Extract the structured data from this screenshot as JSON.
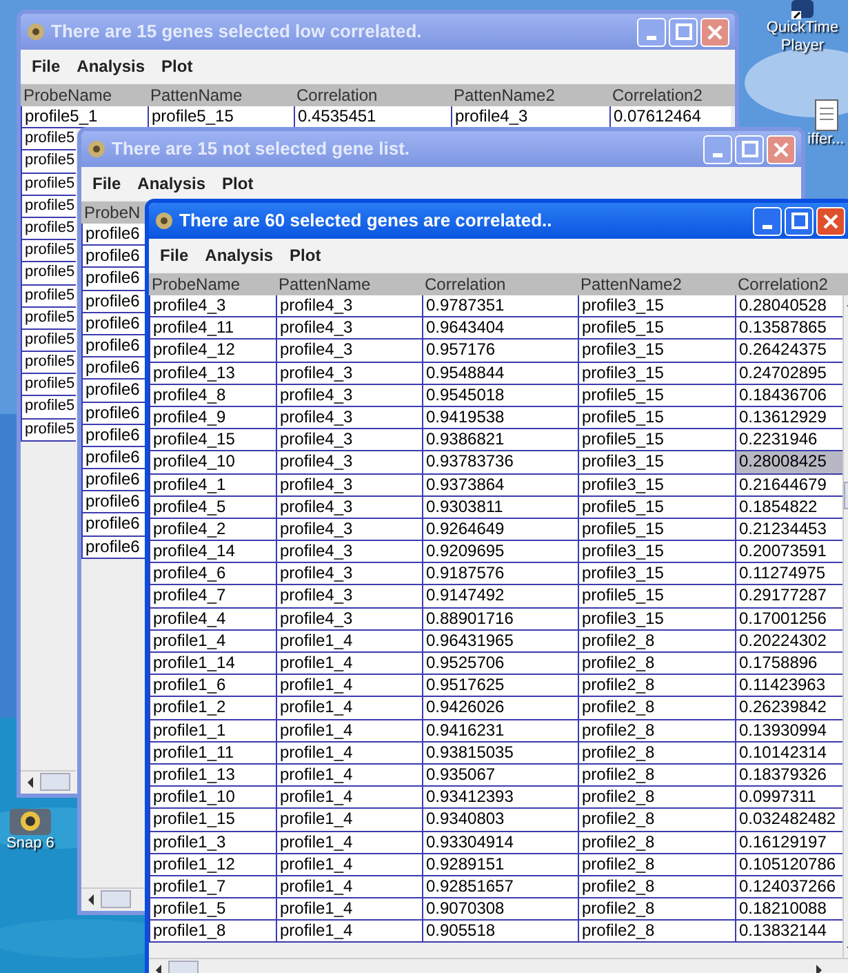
{
  "desktop_icons": [
    {
      "label": "QuickTime Player",
      "kind": "app"
    },
    {
      "label": "iffer...",
      "kind": "document"
    },
    {
      "label": "Snap 6",
      "kind": "camera"
    }
  ],
  "windows": [
    {
      "title": "There are 15 genes selected low correlated.",
      "active": false,
      "menu": [
        "File",
        "Analysis",
        "Plot"
      ],
      "columns": [
        "ProbeName",
        "PattenName",
        "Correlation",
        "PattenName2",
        "Correlation2"
      ],
      "rows": [
        [
          "profile5_1",
          "profile5_15",
          "0.4535451",
          "profile4_3",
          "0.07612464"
        ],
        [
          "profile5"
        ],
        [
          "profile5"
        ],
        [
          "profile5"
        ],
        [
          "profile5"
        ],
        [
          "profile5"
        ],
        [
          "profile5"
        ],
        [
          "profile5"
        ],
        [
          "profile5"
        ],
        [
          "profile5"
        ],
        [
          "profile5"
        ],
        [
          "profile5"
        ],
        [
          "profile5"
        ],
        [
          "profile5"
        ],
        [
          "profile5"
        ]
      ]
    },
    {
      "title": "There are 15 not selected gene list.",
      "active": false,
      "menu": [
        "File",
        "Analysis",
        "Plot"
      ],
      "columns": [
        "ProbeN"
      ],
      "rows": [
        [
          "profile6"
        ],
        [
          "profile6"
        ],
        [
          "profile6"
        ],
        [
          "profile6"
        ],
        [
          "profile6"
        ],
        [
          "profile6"
        ],
        [
          "profile6"
        ],
        [
          "profile6"
        ],
        [
          "profile6"
        ],
        [
          "profile6"
        ],
        [
          "profile6"
        ],
        [
          "profile6"
        ],
        [
          "profile6"
        ],
        [
          "profile6"
        ],
        [
          "profile6"
        ]
      ]
    },
    {
      "title": "There are 60 selected genes are correlated..",
      "active": true,
      "menu": [
        "File",
        "Analysis",
        "Plot"
      ],
      "columns": [
        "ProbeName",
        "PattenName",
        "Correlation",
        "PattenName2",
        "Correlation2"
      ],
      "rows": [
        {
          "cells": [
            "profile4_3",
            "profile4_3",
            "0.9787351",
            "profile3_15",
            "0.28040528"
          ],
          "selected": false
        },
        {
          "cells": [
            "profile4_11",
            "profile4_3",
            "0.9643404",
            "profile5_15",
            "0.13587865"
          ],
          "selected": false
        },
        {
          "cells": [
            "profile4_12",
            "profile4_3",
            "0.957176",
            "profile3_15",
            "0.26424375"
          ],
          "selected": false
        },
        {
          "cells": [
            "profile4_13",
            "profile4_3",
            "0.9548844",
            "profile3_15",
            "0.24702895"
          ],
          "selected": false
        },
        {
          "cells": [
            "profile4_8",
            "profile4_3",
            "0.9545018",
            "profile5_15",
            "0.18436706"
          ],
          "selected": false
        },
        {
          "cells": [
            "profile4_9",
            "profile4_3",
            "0.9419538",
            "profile5_15",
            "0.13612929"
          ],
          "selected": false
        },
        {
          "cells": [
            "profile4_15",
            "profile4_3",
            "0.9386821",
            "profile5_15",
            "0.2231946"
          ],
          "selected": false
        },
        {
          "cells": [
            "profile4_10",
            "profile4_3",
            "0.93783736",
            "profile3_15",
            "0.28008425"
          ],
          "selected": true
        },
        {
          "cells": [
            "profile4_1",
            "profile4_3",
            "0.9373864",
            "profile3_15",
            "0.21644679"
          ],
          "selected": false
        },
        {
          "cells": [
            "profile4_5",
            "profile4_3",
            "0.9303811",
            "profile5_15",
            "0.1854822"
          ],
          "selected": false
        },
        {
          "cells": [
            "profile4_2",
            "profile4_3",
            "0.9264649",
            "profile5_15",
            "0.21234453"
          ],
          "selected": false
        },
        {
          "cells": [
            "profile4_14",
            "profile4_3",
            "0.9209695",
            "profile3_15",
            "0.20073591"
          ],
          "selected": false
        },
        {
          "cells": [
            "profile4_6",
            "profile4_3",
            "0.9187576",
            "profile3_15",
            "0.11274975"
          ],
          "selected": false
        },
        {
          "cells": [
            "profile4_7",
            "profile4_3",
            "0.9147492",
            "profile5_15",
            "0.29177287"
          ],
          "selected": false
        },
        {
          "cells": [
            "profile4_4",
            "profile4_3",
            "0.88901716",
            "profile3_15",
            "0.17001256"
          ],
          "selected": false
        },
        {
          "cells": [
            "profile1_4",
            "profile1_4",
            "0.96431965",
            "profile2_8",
            "0.20224302"
          ],
          "selected": false
        },
        {
          "cells": [
            "profile1_14",
            "profile1_4",
            "0.9525706",
            "profile2_8",
            "0.1758896"
          ],
          "selected": false
        },
        {
          "cells": [
            "profile1_6",
            "profile1_4",
            "0.9517625",
            "profile2_8",
            "0.11423963"
          ],
          "selected": false
        },
        {
          "cells": [
            "profile1_2",
            "profile1_4",
            "0.9426026",
            "profile2_8",
            "0.26239842"
          ],
          "selected": false
        },
        {
          "cells": [
            "profile1_1",
            "profile1_4",
            "0.9416231",
            "profile2_8",
            "0.13930994"
          ],
          "selected": false
        },
        {
          "cells": [
            "profile1_11",
            "profile1_4",
            "0.93815035",
            "profile2_8",
            "0.10142314"
          ],
          "selected": false
        },
        {
          "cells": [
            "profile1_13",
            "profile1_4",
            "0.935067",
            "profile2_8",
            "0.18379326"
          ],
          "selected": false
        },
        {
          "cells": [
            "profile1_10",
            "profile1_4",
            "0.93412393",
            "profile2_8",
            "0.0997311"
          ],
          "selected": false
        },
        {
          "cells": [
            "profile1_15",
            "profile1_4",
            "0.9340803",
            "profile2_8",
            "0.032482482"
          ],
          "selected": false
        },
        {
          "cells": [
            "profile1_3",
            "profile1_4",
            "0.93304914",
            "profile2_8",
            "0.16129197"
          ],
          "selected": false
        },
        {
          "cells": [
            "profile1_12",
            "profile1_4",
            "0.9289151",
            "profile2_8",
            "0.105120786"
          ],
          "selected": false
        },
        {
          "cells": [
            "profile1_7",
            "profile1_4",
            "0.92851657",
            "profile2_8",
            "0.124037266"
          ],
          "selected": false
        },
        {
          "cells": [
            "profile1_5",
            "profile1_4",
            "0.9070308",
            "profile2_8",
            "0.18210088"
          ],
          "selected": false
        },
        {
          "cells": [
            "profile1_8",
            "profile1_4",
            "0.905518",
            "profile2_8",
            "0.13832144"
          ],
          "selected": false
        }
      ]
    }
  ]
}
